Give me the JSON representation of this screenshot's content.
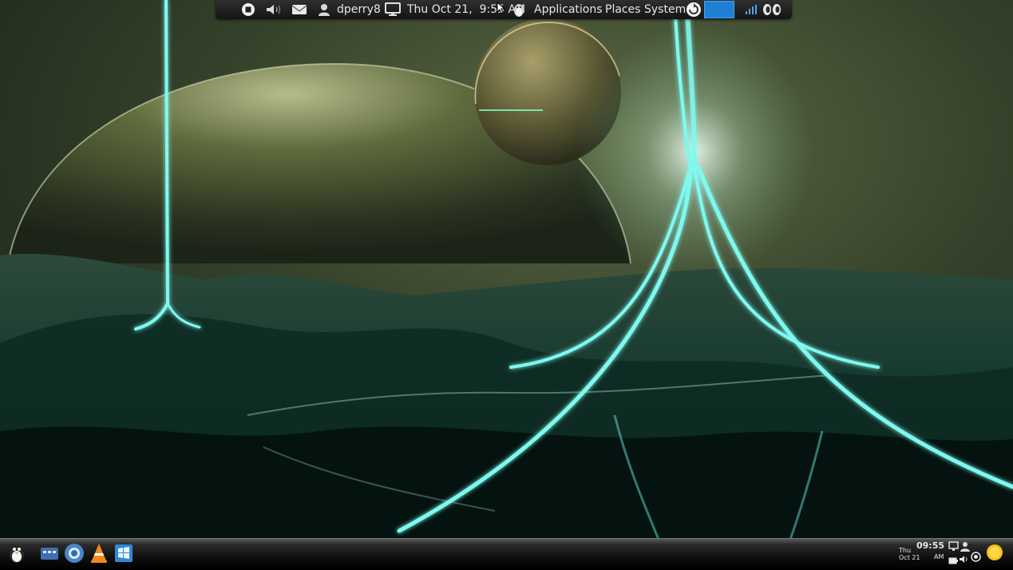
{
  "top_panel": {
    "username": "dperry8",
    "datetime": "Thu Oct 21,  9:55 AM",
    "menu_applications": "Applications",
    "menu_places": "Places",
    "menu_system": "System",
    "icons": [
      "stop-icon",
      "volume-icon",
      "mail-icon",
      "user-icon",
      "monitor-icon",
      "tux-icon",
      "update-icon",
      "network-signal-icon",
      "footprint-icon"
    ],
    "accent_color": "#1e7fd6"
  },
  "dock": {
    "launchers": [
      "tux-menu-icon",
      "file-manager-icon",
      "chromium-icon",
      "vlc-icon",
      "windows-icon"
    ],
    "clock_time": "09:55",
    "clock_day": "Thu",
    "clock_date": "Oct 21",
    "clock_ampm": "AM",
    "tray_icons": [
      "network-icon",
      "battery-icon",
      "speaker-icon",
      "record-icon",
      "weather-sun-icon"
    ]
  },
  "wallpaper": {
    "theme": "alien planets with glowing energy beams",
    "colors": {
      "sky": "#3b4a2c",
      "glow": "#6ff5ee",
      "planet": "#8a9468"
    }
  }
}
